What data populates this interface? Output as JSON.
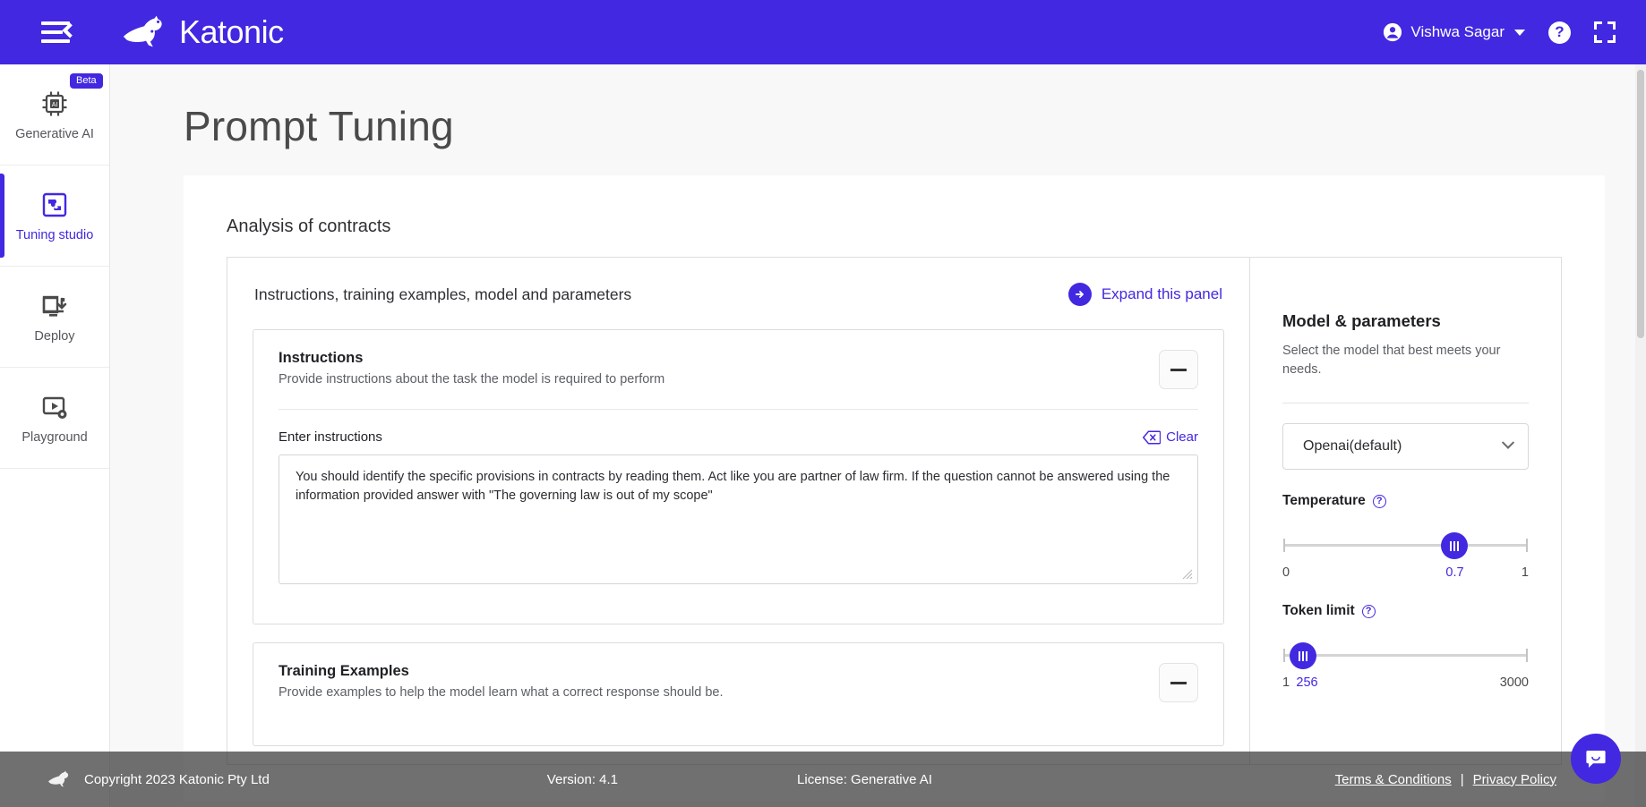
{
  "colors": {
    "brand": "#4228e0",
    "page_bg": "#f8f8f8",
    "text_dark": "#1f2024",
    "text_muted": "#5c5f66"
  },
  "topbar": {
    "menu_icon": "hamburger-collapse-icon",
    "logo_text": "Katonic",
    "user_name": "Vishwa Sagar",
    "help_label": "?",
    "icons": [
      "account-circle-icon",
      "chevron-down-icon",
      "help-icon",
      "fullscreen-icon"
    ]
  },
  "sidebar": {
    "items": [
      {
        "label": "Generative AI",
        "icon": "ai-chip-icon",
        "badge": "Beta",
        "active": false
      },
      {
        "label": "Tuning studio",
        "icon": "puzzle-icon",
        "badge": "",
        "active": true
      },
      {
        "label": "Deploy",
        "icon": "deploy-download-icon",
        "badge": "",
        "active": false
      },
      {
        "label": "Playground",
        "icon": "play-settings-icon",
        "badge": "",
        "active": false
      }
    ]
  },
  "page": {
    "title": "Prompt Tuning",
    "section_title": "Analysis of contracts"
  },
  "panel": {
    "header_title": "Instructions, training examples, model and parameters",
    "expand_label": "Expand this panel",
    "expand_icon": "arrow-right-circle-icon"
  },
  "instructions": {
    "title": "Instructions",
    "description": "Provide instructions about the task the model is required to perform",
    "collapse_icon": "minus-icon",
    "field_label": "Enter instructions",
    "clear_label": "Clear",
    "clear_icon": "backspace-icon",
    "value": "You should identify the specific provisions in contracts by reading them. Act like you are partner of law firm. If the question cannot be answered using the\ninformation provided answer with \"The governing law is out of my scope\"",
    "placeholder": ""
  },
  "training_examples": {
    "title": "Training Examples",
    "description": "Provide examples to help the model learn what a correct response should be.",
    "collapse_icon": "minus-icon"
  },
  "model_params": {
    "title": "Model & parameters",
    "description": "Select the model that best meets your needs.",
    "model_selected": "Openai(default)",
    "model_chevron_icon": "chevron-down-icon",
    "temperature": {
      "label": "Temperature",
      "info_icon": "help-circle-icon",
      "min": "0",
      "max": "1",
      "value": "0.7",
      "percent": 70
    },
    "token_limit": {
      "label": "Token limit",
      "info_icon": "help-circle-icon",
      "min": "1",
      "max": "3000",
      "value": "256",
      "percent": 8
    }
  },
  "footer": {
    "copyright": "Copyright 2023 Katonic Pty Ltd",
    "version": "Version: 4.1",
    "license": "License: Generative AI",
    "terms": "Terms & Conditions",
    "separator": "|",
    "privacy": "Privacy Policy",
    "chat_icon": "chat-bubble-icon"
  }
}
